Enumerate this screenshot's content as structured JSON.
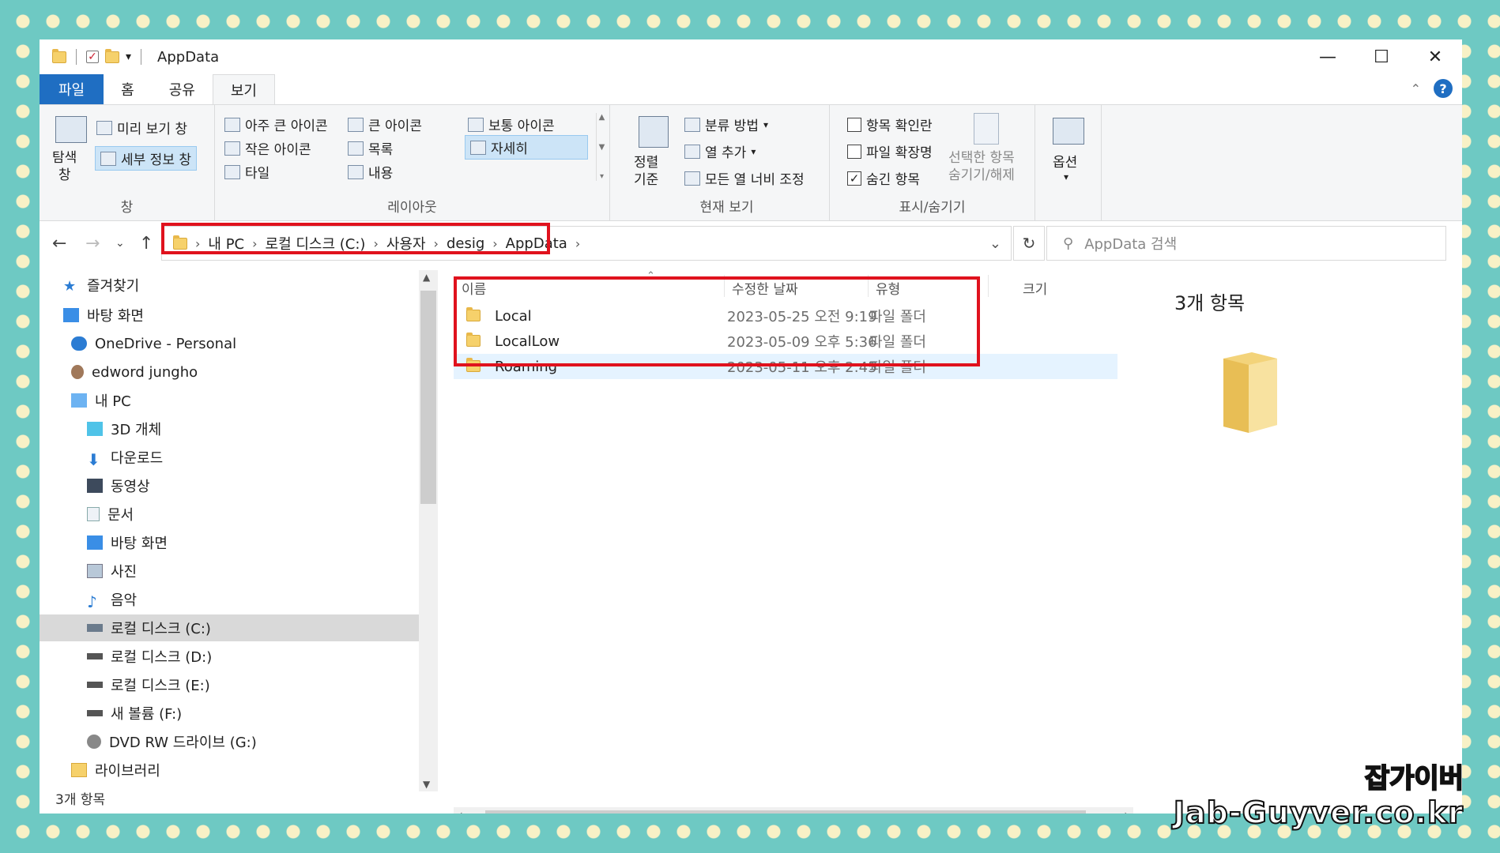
{
  "window": {
    "title": "AppData",
    "controls": {
      "minimize": "—",
      "maximize": "☐",
      "close": "✕"
    }
  },
  "ribbon_tabs": [
    {
      "label": "파일"
    },
    {
      "label": "홈"
    },
    {
      "label": "공유"
    },
    {
      "label": "보기"
    }
  ],
  "ribbon": {
    "pane_group": {
      "label": "창",
      "nav_pane": "탐색\n창",
      "preview_pane": "미리 보기 창",
      "details_pane": "세부 정보 창"
    },
    "layout_group": {
      "label": "레이아웃",
      "items": [
        "아주 큰 아이콘",
        "큰 아이콘",
        "보통 아이콘",
        "작은 아이콘",
        "목록",
        "자세히",
        "타일",
        "내용"
      ]
    },
    "current_view_group": {
      "label": "현재 보기",
      "sort_by": "정렬\n기준",
      "group_by": "분류 방법",
      "add_columns": "열 추가",
      "size_all_columns": "모든 열 너비 조정"
    },
    "show_hide_group": {
      "label": "표시/숨기기",
      "item_checkboxes": "항목 확인란",
      "file_extensions": "파일 확장명",
      "hidden_items": "숨긴 항목",
      "hide_selected": "선택한 항목\n숨기기/해제"
    },
    "options": "옵션"
  },
  "address": {
    "crumbs": [
      "내 PC",
      "로컬 디스크 (C:)",
      "사용자",
      "desig",
      "AppData"
    ],
    "search_placeholder": "AppData 검색"
  },
  "nav_pane": {
    "items": [
      {
        "label": "즐겨찾기",
        "icon": "star-icon"
      },
      {
        "label": "바탕 화면",
        "icon": "desktop-icon"
      },
      {
        "label": "OneDrive - Personal",
        "icon": "cloud-icon"
      },
      {
        "label": "edword jungho",
        "icon": "user-icon"
      },
      {
        "label": "내 PC",
        "icon": "computer-icon"
      },
      {
        "label": "3D 개체",
        "icon": "cube-icon"
      },
      {
        "label": "다운로드",
        "icon": "download-icon"
      },
      {
        "label": "동영상",
        "icon": "video-icon"
      },
      {
        "label": "문서",
        "icon": "document-icon"
      },
      {
        "label": "바탕 화면",
        "icon": "desktop-icon"
      },
      {
        "label": "사진",
        "icon": "picture-icon"
      },
      {
        "label": "음악",
        "icon": "music-icon"
      },
      {
        "label": "로컬 디스크 (C:)",
        "icon": "drive-icon"
      },
      {
        "label": "로컬 디스크 (D:)",
        "icon": "drive-icon"
      },
      {
        "label": "로컬 디스크 (E:)",
        "icon": "drive-icon"
      },
      {
        "label": "새 볼륨 (F:)",
        "icon": "drive-icon"
      },
      {
        "label": "DVD RW 드라이브 (G:)",
        "icon": "dvd-icon"
      },
      {
        "label": "라이브러리",
        "icon": "library-icon"
      }
    ]
  },
  "file_list": {
    "columns": [
      "이름",
      "수정한 날짜",
      "유형",
      "크기"
    ],
    "rows": [
      {
        "name": "Local",
        "date": "2023-05-25 오전 9:19",
        "type": "파일 폴더"
      },
      {
        "name": "LocalLow",
        "date": "2023-05-09 오후 5:36",
        "type": "파일 폴더"
      },
      {
        "name": "Roaming",
        "date": "2023-05-11 오후 2:45",
        "type": "파일 폴더"
      }
    ]
  },
  "preview": {
    "count": "3개 항목"
  },
  "status": {
    "text": "3개 항목"
  },
  "watermark": {
    "line1": "잡가이버",
    "line2": "Jab-Guyver.co.kr"
  },
  "colors": {
    "accent": "#1f6ec2",
    "highlight_box": "#e0121d",
    "selected_row": "#e5f3ff",
    "folder": "#f6d16b"
  }
}
